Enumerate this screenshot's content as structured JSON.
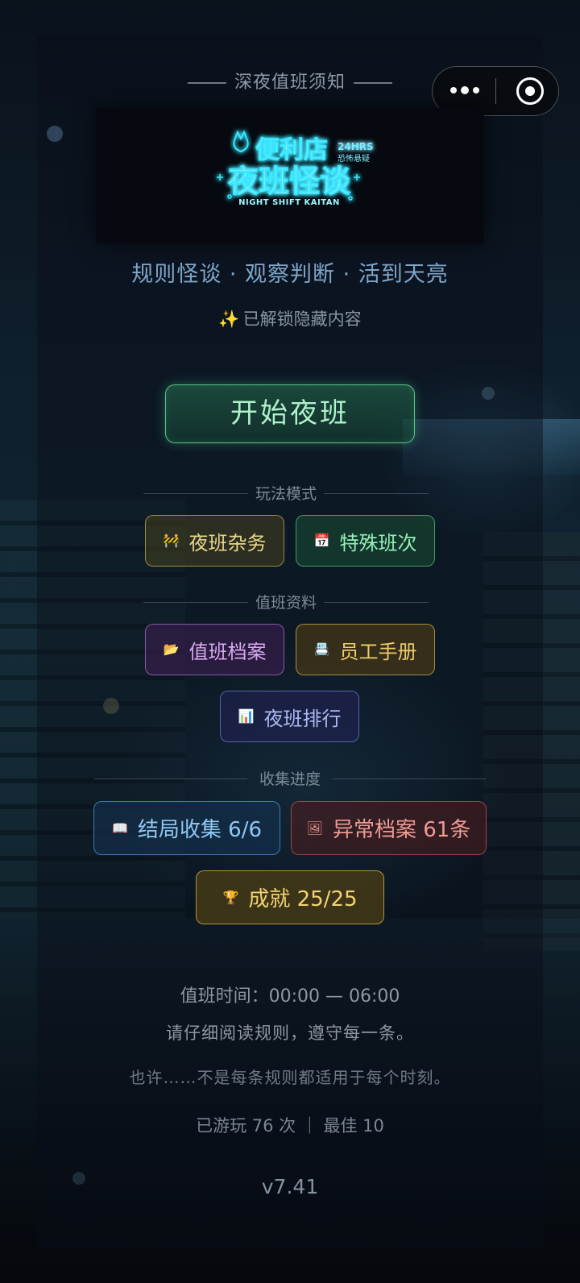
{
  "header": {
    "notice": "深夜值班须知",
    "capsule": {
      "more_icon": "more-dots-icon",
      "close_icon": "target-close-icon"
    }
  },
  "logo": {
    "title_line1": "便利店",
    "title_line2": "夜班怪谈",
    "badge_top": "24HRS",
    "badge_bottom": "恐怖悬疑",
    "subtitle": "NIGHT SHIFT KAITAN"
  },
  "tagline": "规则怪谈 · 观察判断 · 活到天亮",
  "unlocked": {
    "icon": "✨",
    "text": "已解锁隐藏内容"
  },
  "start_button": "开始夜班",
  "sections": {
    "modes": "玩法模式",
    "records": "值班资料",
    "progress": "收集进度"
  },
  "buttons": {
    "chores": {
      "icon": "🚧",
      "label": "夜班杂务"
    },
    "special": {
      "icon": "📅",
      "label": "特殊班次"
    },
    "archive": {
      "icon": "📂",
      "label": "值班档案"
    },
    "manual": {
      "icon": "📇",
      "label": "员工手册"
    },
    "ranking": {
      "icon": "📊",
      "label": "夜班排行"
    },
    "endings": {
      "icon": "📖",
      "label": "结局收集 6/6"
    },
    "anomalies": {
      "icon": "🖼",
      "label": "异常档案 61条"
    },
    "achievements": {
      "icon": "🏆",
      "label": "成就 25/25"
    }
  },
  "footer": {
    "shift_time": "值班时间：00:00 — 06:00",
    "read_rules": "请仔细阅读规则，遵守每一条。",
    "hint": "也许……不是每条规则都适用于每个时刻。",
    "stats": "已游玩 76 次 ｜ 最佳 10",
    "version": "v7.41"
  },
  "colors": {
    "accent_green": "#58c48a",
    "neon_cyan": "#39e6ff",
    "tagline_blue": "#7fa6c9"
  }
}
